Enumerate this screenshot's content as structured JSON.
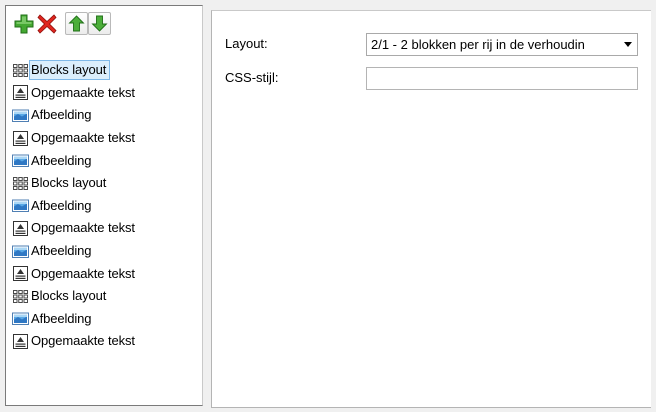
{
  "toolbar": {
    "buttons": [
      {
        "icon": "add-icon",
        "color": "#3a9a2a"
      },
      {
        "icon": "delete-icon",
        "color": "#d8231f"
      },
      {
        "icon": "move-up-icon",
        "color": "#3a9a2a"
      },
      {
        "icon": "move-down-icon",
        "color": "#3a9a2a"
      }
    ]
  },
  "tree": {
    "selected_index": 0,
    "items": [
      {
        "type": "blocks-layout",
        "label": "Blocks layout"
      },
      {
        "type": "formatted-text",
        "label": "Opgemaakte tekst"
      },
      {
        "type": "image",
        "label": "Afbeelding"
      },
      {
        "type": "formatted-text",
        "label": "Opgemaakte tekst"
      },
      {
        "type": "image",
        "label": "Afbeelding"
      },
      {
        "type": "blocks-layout",
        "label": "Blocks layout"
      },
      {
        "type": "image",
        "label": "Afbeelding"
      },
      {
        "type": "formatted-text",
        "label": "Opgemaakte tekst"
      },
      {
        "type": "image",
        "label": "Afbeelding"
      },
      {
        "type": "formatted-text",
        "label": "Opgemaakte tekst"
      },
      {
        "type": "blocks-layout",
        "label": "Blocks layout"
      },
      {
        "type": "image",
        "label": "Afbeelding"
      },
      {
        "type": "formatted-text",
        "label": "Opgemaakte tekst"
      }
    ]
  },
  "properties": {
    "layout_label": "Layout:",
    "layout_value": "2/1 - 2 blokken per rij in de verhoudin",
    "css_label": "CSS-stijl:",
    "css_value": ""
  },
  "colors": {
    "selection_bg": "#dbeefc",
    "selection_border": "#7fb8e8",
    "pane_border": "#7a7a7a"
  }
}
